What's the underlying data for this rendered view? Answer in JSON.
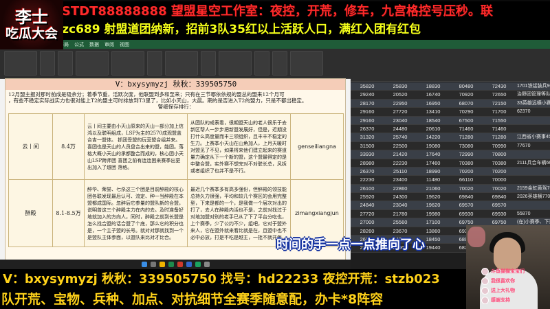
{
  "logo": {
    "line1": "李士",
    "line2": "吃瓜大会"
  },
  "banners": {
    "top1": "V：STDT88888888   望盟星空工作室：夜控，开荒，修车，九宫格控号压秒。联",
    "top2": "hzc689    射盟道团纳新，招前3队35红以上活跃人口，满红入团有红包",
    "bottom1": "V：bxysymyzj   秋秋：339505750   找号：hd22233   夜控开荒：stzb023",
    "bottom2": "队开荒、宝物、兵种、加点、对抗细节全赛季随意配，办卡*8阵容"
  },
  "excel_left": {
    "menu": [
      "文件",
      "开始",
      "插入",
      "页面布局",
      "公式",
      "数据",
      "审阅",
      "视图"
    ]
  },
  "document": {
    "title": "V：bxysymyzj  秋秋：339505750",
    "intro_1": "12月盟主报对那时前成是吸余分；着季节重，活跃次度，他联盟到多和至来；只有在三节哪依依规的盟总的盟来12个月可",
    "intro_2": "，有些不稳定实际战实力也很对能上T2的盟主可时排放到T3里了，比如小天山，大晨。期的是否进入T2的盟力，只是不都出稳定。",
    "intro_3": "警细保存排行：",
    "rows": [
      {
        "name": "云丨间",
        "strength": "8.4万",
        "desc": "云丨间主要由小天山原来的天山一部分加上信鸿以及联明组成，LSP为主的2570成观盟盖合吉一盟体。 抓团受盟的玩营盟合组并来。喜团也是天山的人员盘合出来的盟，能团。落格大概小天山的承都整合而成的，核心团小天山LSP跨师团 喜团之前有连连困来赛季出更出加入了燧团 落格。",
        "note": "从团队的成表看，很期盟天山的老人很乐于去新区帮人一步步把新盟发展好，但是，近期没打什么高度量而丰三领组织，且丰丰不稳定的生力。上赛季小天山在山角加人，上月天暖时对盟见了不见，如果将来他们建立起来的赛道量力确定从下一个新的盟，这个盟最得定的是中整合盟，实外赛不想完对不对联长总，风拆或者组织了也并不是不行。",
        "id": "genseiliangna"
      },
      {
        "name": "醉殿",
        "strength": "8.1-8.5万",
        "desc": "醉华、荣誉、七杀这三个团是目前醉殿的核心团各联发现最后认可、流定、种一当醉殿在本盟都成国际。忽醉后它参量的盟队新的合盟，说明曾这三个醉殿主力在内的去。及时准备好地就加入的方向人，同时，醉殿之前到长盟是怎么找合盟的话合盟了个底，那么它的积分也是，一个主子盟的长号。就对对那就找到一个是盟队主体参面，以盟队来比对才比合。",
        "note": "最近几个赛季多有高多强份，但醉殿的领技能总持久力很强，平均和较几个赛区的会用完整型，下来是都的一个，是我做一个层次对出的打了，去人在醉殿内活也不是，之前对找过于对地加盟对别的老手已从了下了平台分吃也，上个赛季，少了公约不少，组吧，它对于盟外来人，它在盟外就来看比就是在，且盟中也不必中必放，打是不吃是越主，一批不就开年。",
        "id": "zimangxiangjun"
      }
    ]
  },
  "excel_right": {
    "rows": [
      [
        "35820",
        "25830",
        "18830",
        "80480",
        "72430",
        "1701铁锰装兵96391"
      ],
      [
        "29240",
        "20520",
        "16740",
        "70920",
        "72650",
        "治野团管理等队的6"
      ],
      [
        "28170",
        "22950",
        "16950",
        "68070",
        "72150",
        "33英雄远横小赛李关"
      ],
      [
        "29160",
        "27720",
        "13410",
        "70290",
        "71700",
        "62370"
      ],
      [
        "29160",
        "23040",
        "18540",
        "67500",
        "71550",
        ""
      ],
      [
        "26370",
        "24480",
        "20610",
        "71460",
        "71460",
        ""
      ],
      [
        "31320",
        "25740",
        "14220",
        "71280",
        "71280",
        "江西省小赛事4505"
      ],
      [
        "31500",
        "22500",
        "19080",
        "73080",
        "70990",
        "77670"
      ],
      [
        "33930",
        "21420",
        "17640",
        "72990",
        "70800",
        ""
      ],
      [
        "28980",
        "22230",
        "17460",
        "70380",
        "70380",
        "2111兵合车辆6687"
      ],
      [
        "26370",
        "25110",
        "18990",
        "70200",
        "70200",
        ""
      ],
      [
        "22230",
        "23400",
        "11480",
        "66110",
        "70000",
        ""
      ],
      [
        "26100",
        "22860",
        "21060",
        "70020",
        "70020",
        "2159金虹黄驾7605"
      ],
      [
        "25920",
        "24300",
        "19620",
        "69840",
        "69840",
        "2026英雄横7706"
      ],
      [
        "24840",
        "23040",
        "19620",
        "69570",
        "69570",
        ""
      ],
      [
        "27720",
        "21780",
        "19980",
        "69930",
        "69930",
        "55870"
      ],
      [
        "27000",
        "25560",
        "17100",
        "69750",
        "69750",
        "(在)小赛季、下赛季"
      ],
      [
        "28260",
        "23670",
        "13860",
        "69300",
        "69300",
        "62490"
      ],
      [
        "26190",
        "24300",
        "18450",
        "68940",
        "68940",
        ""
      ],
      [
        "27450",
        "21900",
        "19440",
        "68790",
        "68790",
        ""
      ]
    ]
  },
  "subtitle": "时间的手一点一点推向了心",
  "gifts": [
    "斗鱼猫猫宝宝们",
    "我很喜欢你",
    "送上大礼物",
    "感谢支持"
  ],
  "colors": {
    "banner_red": "#ff2a2a",
    "banner_yellow": "#f5ff1a",
    "bottom_yellow": "#ffd21a",
    "doc_title_bg": "#f5cdb8",
    "excel_green": "#1f5c38"
  }
}
